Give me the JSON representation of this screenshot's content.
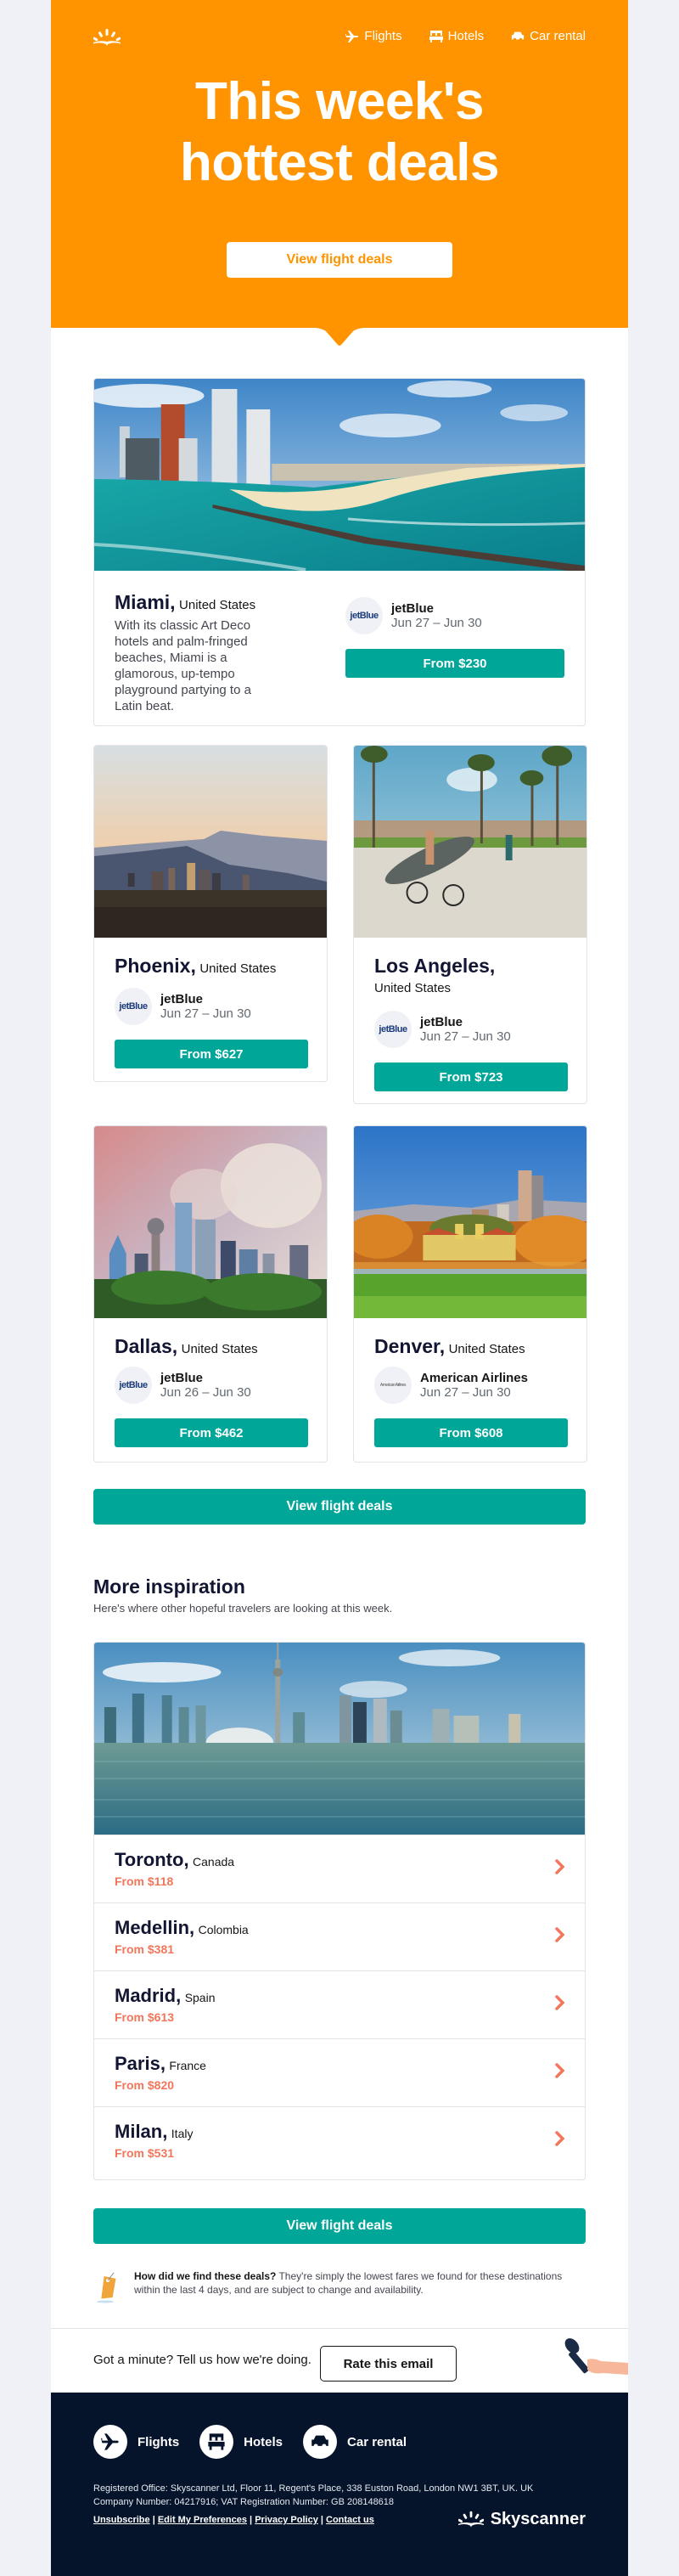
{
  "header": {
    "nav": [
      {
        "icon": "plane-icon",
        "label": "Flights"
      },
      {
        "icon": "bed-icon",
        "label": "Hotels"
      },
      {
        "icon": "car-icon",
        "label": "Car rental"
      }
    ],
    "title_line1": "This week's",
    "title_line2": "hottest deals",
    "cta": "View flight deals"
  },
  "featured": {
    "city": "Miami,",
    "country": "United States",
    "description": "With its classic Art Deco hotels and palm-fringed beaches, Miami is a glamorous, up-tempo playground partying to a Latin beat.",
    "airline_logo": "jetBlue",
    "airline": "jetBlue",
    "dates": "Jun 27 – Jun 30",
    "price": "From $230"
  },
  "deals": [
    {
      "city": "Phoenix,",
      "country": "United States",
      "airline_logo": "jetBlue",
      "airline": "jetBlue",
      "dates": "Jun 27 – Jun 30",
      "price": "From $627"
    },
    {
      "city": "Los Angeles,",
      "country": "United States",
      "airline_logo": "jetBlue",
      "airline": "jetBlue",
      "dates": "Jun 27 – Jun 30",
      "price": "From $723"
    },
    {
      "city": "Dallas,",
      "country": "United States",
      "airline_logo": "jetBlue",
      "airline": "jetBlue",
      "dates": "Jun 26 – Jun 30",
      "price": "From $462"
    },
    {
      "city": "Denver,",
      "country": "United States",
      "airline_logo": "American Airlines",
      "airline": "American Airlines",
      "dates": "Jun 27 – Jun 30",
      "price": "From $608"
    }
  ],
  "cta_mid": "View flight deals",
  "inspiration": {
    "title": "More inspiration",
    "subtitle": "Here's where other hopeful travelers are looking at this week.",
    "items": [
      {
        "city": "Toronto,",
        "country": "Canada",
        "price": "From $118"
      },
      {
        "city": "Medellin,",
        "country": "Colombia",
        "price": "From $381"
      },
      {
        "city": "Madrid,",
        "country": "Spain",
        "price": "From $613"
      },
      {
        "city": "Paris,",
        "country": "France",
        "price": "From $820"
      },
      {
        "city": "Milan,",
        "country": "Italy",
        "price": "From $531"
      }
    ]
  },
  "cta_bottom": "View flight deals",
  "info": {
    "question": "How did we find these deals?",
    "text": " They're simply the lowest fares we found for these destinations within the last 4 days, and are subject to change and availability."
  },
  "rate": {
    "question": "Got a minute? Tell us how we're doing.",
    "button": "Rate this email"
  },
  "footer": {
    "nav": [
      {
        "icon": "plane-icon",
        "label": "Flights"
      },
      {
        "icon": "bed-icon",
        "label": "Hotels"
      },
      {
        "icon": "car-icon",
        "label": "Car rental"
      }
    ],
    "legal_line1": "Registered Office: Skyscanner Ltd, Floor 11, Regent's Place, 338 Euston Road, London NW1 3BT, UK. UK",
    "legal_line2": "Company Number: 04217916; VAT Registration Number: GB 208148618",
    "links": [
      "Unsubscribe",
      "Edit My Preferences",
      "Privacy Policy",
      "Contact us"
    ],
    "separator": " | ",
    "brand": "Skyscanner"
  },
  "colors": {
    "brand_orange": "#ff9400",
    "teal": "#00a698",
    "price_coral": "#f2765a",
    "footer_navy": "#05142b",
    "page_bg": "#eff1f6"
  }
}
